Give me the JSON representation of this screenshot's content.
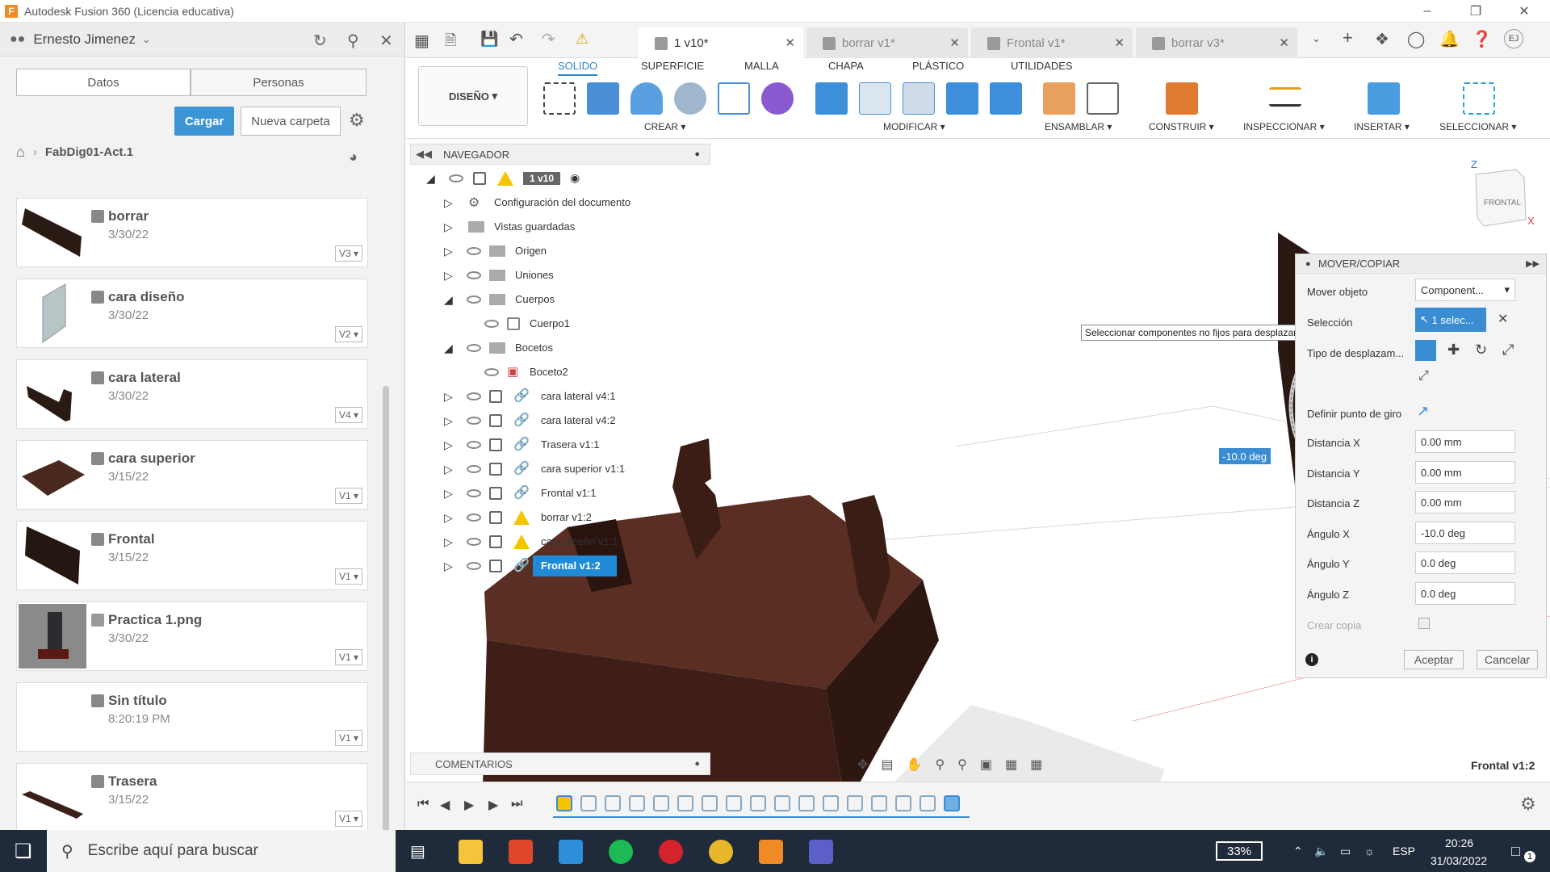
{
  "app": {
    "title": "Autodesk Fusion 360 (Licencia educativa)",
    "logo_letter": "F"
  },
  "left": {
    "user": "Ernesto Jimenez",
    "tabs": [
      "Datos",
      "Personas"
    ],
    "upload": "Cargar",
    "new_folder": "Nueva carpeta",
    "breadcrumb": "FabDig01-Act.1",
    "files": [
      {
        "name": "borrar",
        "date": "3/30/22",
        "version": "V3"
      },
      {
        "name": "cara diseño",
        "date": "3/30/22",
        "version": "V2"
      },
      {
        "name": "cara lateral",
        "date": "3/30/22",
        "version": "V4"
      },
      {
        "name": "cara superior",
        "date": "3/15/22",
        "version": "V1"
      },
      {
        "name": "Frontal",
        "date": "3/15/22",
        "version": "V1"
      },
      {
        "name": "Practica 1.png",
        "date": "3/30/22",
        "version": "V1"
      },
      {
        "name": "Sin título",
        "date": "8:20:19 PM",
        "version": "V1"
      },
      {
        "name": "Trasera",
        "date": "3/15/22",
        "version": "V1"
      }
    ]
  },
  "doc_tabs": [
    {
      "label": "1 v10*",
      "active": true
    },
    {
      "label": "borrar v1*",
      "active": false
    },
    {
      "label": "Frontal v1*",
      "active": false
    },
    {
      "label": "borrar v3*",
      "active": false
    }
  ],
  "ribbon": {
    "workspace": "DISEÑO",
    "tabs": [
      "SOLIDO",
      "SUPERFICIE",
      "MALLA",
      "CHAPA",
      "PLÁSTICO",
      "UTILIDADES"
    ],
    "groups": [
      "CREAR",
      "MODIFICAR",
      "ENSAMBLAR",
      "CONSTRUIR",
      "INSPECCIONAR",
      "INSERTAR",
      "SELECCIONAR"
    ]
  },
  "navigator": {
    "title": "NAVEGADOR",
    "root": "1 v10",
    "items": [
      "Configuración del documento",
      "Vistas guardadas",
      "Origen",
      "Uniones",
      "Cuerpos",
      "Cuerpo1",
      "Bocetos",
      "Boceto2",
      "cara lateral v4:1",
      "cara lateral v4:2",
      "Trasera v1:1",
      "cara superior v1:1",
      "Frontal v1:1",
      "borrar v1:2",
      "cara diseño v1:1",
      "Frontal v1:2"
    ]
  },
  "comments": "COMENTARIOS",
  "viewcube": {
    "face": "FRONTAL",
    "axis_z": "Z",
    "axis_x": "X"
  },
  "tooltip": "Seleccionar componentes no fijos para desplazarlos",
  "angle_input": "-10.0 deg",
  "selected_label": "Frontal v1:2",
  "dialog": {
    "title": "MOVER/COPIAR",
    "move_object_label": "Mover objeto",
    "move_object_value": "Component...",
    "selection_label": "Selección",
    "selection_value": "1 selec...",
    "move_type_label": "Tipo de desplazam...",
    "pivot_label": "Definir punto de giro",
    "dist_x_label": "Distancia X",
    "dist_x": "0.00 mm",
    "dist_y_label": "Distancia Y",
    "dist_y": "0.00 mm",
    "dist_z_label": "Distancia Z",
    "dist_z": "0.00 mm",
    "ang_x_label": "Ángulo X",
    "ang_x": "-10.0 deg",
    "ang_y_label": "Ángulo Y",
    "ang_y": "0.0 deg",
    "ang_z_label": "Ángulo Z",
    "ang_z": "0.0 deg",
    "copy_label": "Crear copia",
    "ok": "Aceptar",
    "cancel": "Cancelar"
  },
  "taskbar": {
    "search": "Escribe aquí para buscar",
    "battery": "33%",
    "lang": "ESP",
    "time": "20:26",
    "date": "31/03/2022",
    "notif": "1"
  }
}
